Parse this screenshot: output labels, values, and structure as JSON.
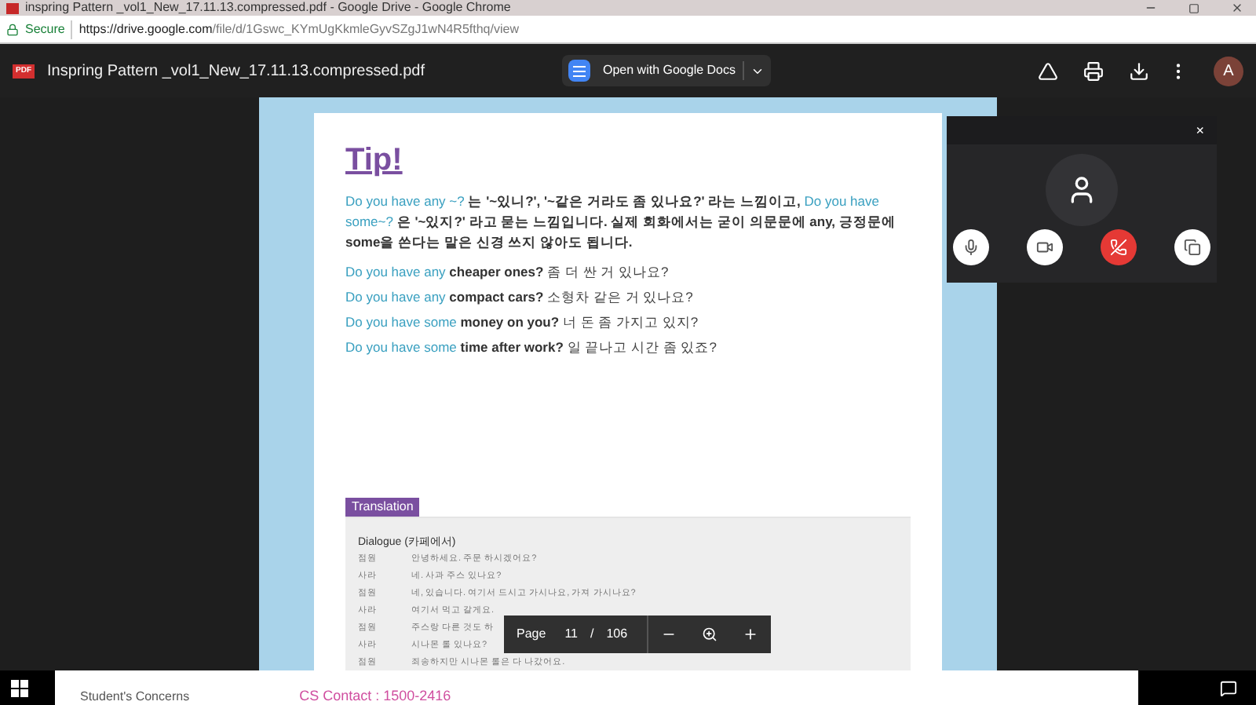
{
  "window": {
    "title": "inspring Pattern _vol1_New_17.11.13.compressed.pdf - Google Drive - Google Chrome"
  },
  "address_bar": {
    "security": "Secure",
    "url_host": "https://drive.google.com",
    "url_path": "/file/d/1Gswc_KYmUgKkmleGyvSZgJ1wN4R5fthq/view"
  },
  "viewer": {
    "file_badge": "PDF",
    "file_name": "Inspring Pattern _vol1_New_17.11.13.compressed.pdf",
    "open_with": "Open with Google Docs",
    "avatar": "A"
  },
  "page": {
    "title": "Tip!",
    "intro": [
      {
        "kind": "pattern",
        "text": "Do you have any ~?"
      },
      {
        "kind": "plain",
        "text": " 는 '~있니?', '~같은 거라도 좀 있나요?' 라는 느낌이고, "
      },
      {
        "kind": "pattern",
        "text": "Do you have some~?"
      },
      {
        "kind": "plain",
        "text": " 은 '~있지?' 라고 묻는 느낌입니다. 실제 회화에서는 굳이 의문문에 any, 긍정문에 some을 쓴다는 말은 신경 쓰지 않아도 됩니다."
      }
    ],
    "examples": [
      {
        "pattern": "Do you have any",
        "rest": "cheaper ones?",
        "korean": "좀 더 싼 거 있나요?"
      },
      {
        "pattern": "Do you have any",
        "rest": "compact cars?",
        "korean": "소형차 같은 거 있나요?"
      },
      {
        "pattern": "Do you have some",
        "rest": "money on you?",
        "korean": "너 돈 좀 가지고 있지?"
      },
      {
        "pattern": "Do you have some",
        "rest": "time after work?",
        "korean": "일 끝나고 시간 좀 있죠?"
      }
    ],
    "translation_tag": "Translation",
    "dialogue_title": "Dialogue (카페에서)",
    "dialogue": [
      {
        "speaker": "점원",
        "line": "안녕하세요. 주문 하시겠어요?"
      },
      {
        "speaker": "사라",
        "line": "네. 사과 주스 있나요?"
      },
      {
        "speaker": "점원",
        "line": "네, 있습니다. 여기서 드시고 가시나요, 가져 가시나요?"
      },
      {
        "speaker": "사라",
        "line": "여기서 먹고 갈게요."
      },
      {
        "speaker": "점원",
        "line": "주스랑 다른 것도 하"
      },
      {
        "speaker": "사라",
        "line": "시나몬 롤 있나요?"
      },
      {
        "speaker": "점원",
        "line": "죄송하지만 시나몬 롤은 다 나갔어요."
      }
    ]
  },
  "page_controls": {
    "label": "Page",
    "current": "11",
    "separator": "/",
    "total": "106"
  },
  "call": {
    "close": "×"
  },
  "taskbar": {
    "window_title": "Student's Concerns",
    "contact": "CS Contact : 1500-2416"
  }
}
